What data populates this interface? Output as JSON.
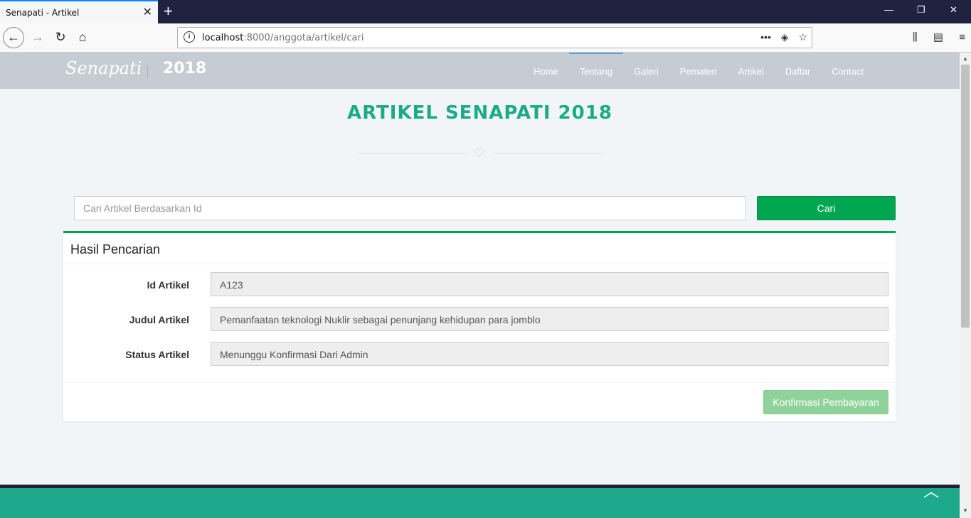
{
  "browser": {
    "tab_title": "Senapati - Artikel",
    "tab_close": "✕",
    "new_tab": "+",
    "url_host": "localhost",
    "url_path": ":8000/anggota/artikel/cari",
    "info_icon": "i",
    "window_controls": [
      "—",
      "❐",
      "✕"
    ]
  },
  "site": {
    "brand": "Senapati",
    "year": "2018",
    "menu": [
      {
        "label": "Home",
        "active": false
      },
      {
        "label": "Tentang",
        "active": true
      },
      {
        "label": "Galeri",
        "active": false
      },
      {
        "label": "Pemateri",
        "active": false
      },
      {
        "label": "Artikel",
        "active": false
      },
      {
        "label": "Daftar",
        "active": false
      },
      {
        "label": "Contact",
        "active": false
      }
    ]
  },
  "main": {
    "title": "ARTIKEL SENAPATI 2018",
    "search": {
      "placeholder": "Cari Artikel Berdasarkan Id",
      "value": "",
      "button": "Cari"
    },
    "panel": {
      "title": "Hasil Pencarian",
      "fields": [
        {
          "label": "Id Artikel",
          "value": "A123"
        },
        {
          "label": "Judul Artikel",
          "value": "Pemanfaatan teknologi Nuklir sebagai penunjang kehidupan para jomblo"
        },
        {
          "label": "Status Artikel",
          "value": "Menunggu Konfirmasi Dari Admin"
        }
      ],
      "confirm_button": "Konfirmasi Pembayaran"
    }
  },
  "colors": {
    "accent_green": "#00a650",
    "title_teal": "#1bab86",
    "footer": "#1ea98d"
  }
}
